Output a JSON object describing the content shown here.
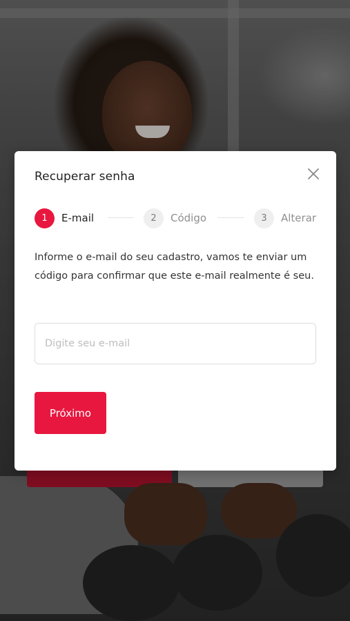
{
  "modal": {
    "title": "Recuperar senha",
    "close_icon": "close-icon",
    "steps": [
      {
        "number": "1",
        "label": "E-mail",
        "active": true
      },
      {
        "number": "2",
        "label": "Código",
        "active": false
      },
      {
        "number": "3",
        "label": "Alterar",
        "active": false
      }
    ],
    "description": "Informe o e-mail do seu cadastro, vamos te enviar um código para confirmar que este e-mail realmente é seu.",
    "email_input": {
      "value": "",
      "placeholder": "Digite seu e-mail"
    },
    "next_button": "Próximo"
  },
  "colors": {
    "accent": "#e8173f",
    "modal_background": "#ffffff"
  }
}
